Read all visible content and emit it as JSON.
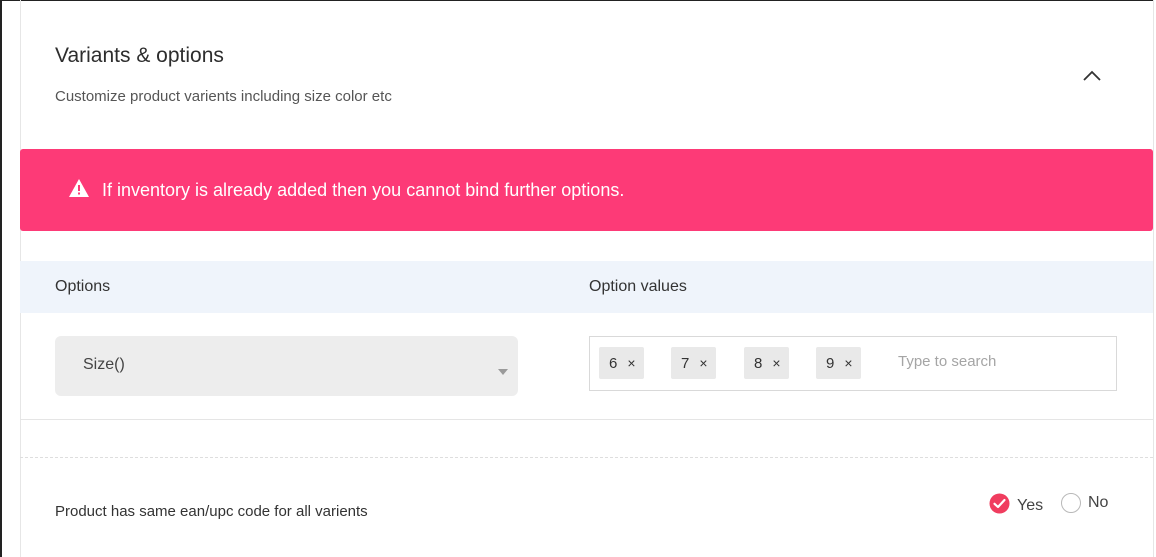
{
  "section": {
    "title": "Variants & options",
    "subtitle": "Customize product varients including size color etc"
  },
  "alert": {
    "message": "If inventory is already added then you cannot bind further options.",
    "color": "#fd3a77"
  },
  "options_table": {
    "options_header": "Options",
    "values_header": "Option values",
    "selected_option": "Size()",
    "tags": [
      {
        "value": "6",
        "remove": "×"
      },
      {
        "value": "7",
        "remove": "×"
      },
      {
        "value": "8",
        "remove": "×"
      },
      {
        "value": "9",
        "remove": "×"
      }
    ],
    "search_placeholder": "Type to search"
  },
  "ean": {
    "label": "Product has same ean/upc code for all varients",
    "yes_label": "Yes",
    "no_label": "No",
    "selected": "Yes",
    "accent": "#f03d5f"
  },
  "icons": {
    "collapse": "chevron-up-icon",
    "alert": "warning-triangle-icon",
    "select": "caret-down-icon",
    "radio_checked": "check-circle-icon"
  }
}
